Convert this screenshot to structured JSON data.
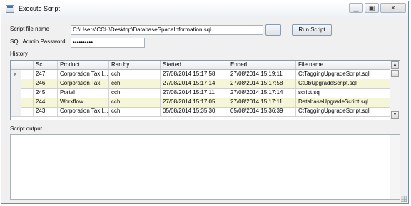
{
  "window": {
    "title": "Execute Script"
  },
  "title_controls": {
    "minimize": "▁",
    "restore": "▣",
    "close": "✕"
  },
  "form": {
    "script_file_label": "Script file name",
    "script_file_value": "C:\\Users\\CCH\\Desktop\\DatabaseSpaceInformation.sql",
    "browse_label": "...",
    "run_label": "Run Script",
    "password_label": "SQL Admin Password",
    "password_value": "••••••••••"
  },
  "history": {
    "label": "History",
    "columns": [
      "Sc...",
      "Product",
      "Ran by",
      "Started",
      "Ended",
      "File name"
    ],
    "rows": [
      [
        "247",
        "Corporation Tax I...",
        "cch,",
        "27/08/2014 15:17:58",
        "27/08/2014 15:19:11",
        "CtTaggingUpgradeScript.sql"
      ],
      [
        "246",
        "Corporation Tax",
        "cch,",
        "27/08/2014 15:17:14",
        "27/08/2014 15:17:58",
        "CtDbUpgradeScript.sql"
      ],
      [
        "245",
        "Portal",
        "cch,",
        "27/08/2014 15:17:11",
        "27/08/2014 15:17:14",
        "script.sql"
      ],
      [
        "244",
        "Workflow",
        "cch,",
        "27/08/2014 15:17:05",
        "27/08/2014 15:17:11",
        "DatabaseUpgradeScript.sql"
      ],
      [
        "243",
        "Corporation Tax I...",
        "cch,",
        "05/08/2014 15:35:30",
        "05/08/2014 15:36:39",
        "CtTaggingUpgradeScript.sql"
      ]
    ],
    "scroll_up": "▲",
    "scroll_down": "▼"
  },
  "output": {
    "label": "Script output",
    "text": ""
  },
  "colors": {
    "alt_row": "#f5f5d8",
    "border": "#8e98a3",
    "title_bg": "#eef1f5"
  }
}
